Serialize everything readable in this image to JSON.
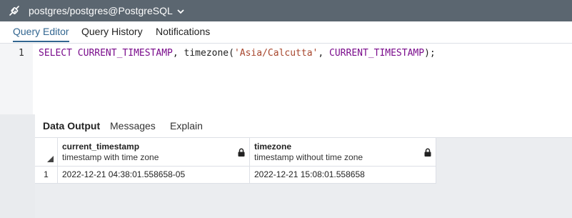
{
  "connection": {
    "title": "postgres/postgres@PostgreSQL",
    "icon": "plug-icon"
  },
  "tabs": [
    {
      "label": "Query Editor",
      "active": true
    },
    {
      "label": "Query History",
      "active": false
    },
    {
      "label": "Notifications",
      "active": false
    }
  ],
  "editor": {
    "line_number": "1",
    "tokens": {
      "kw_select": "SELECT",
      "kw_current_timestamp_1": "CURRENT_TIMESTAMP",
      "txt_comma_1": ", timezone(",
      "str_zone": "'Asia/Calcutta'",
      "txt_comma_2": ", ",
      "kw_current_timestamp_2": "CURRENT_TIMESTAMP",
      "txt_end": ");"
    }
  },
  "results": {
    "tabs": [
      {
        "label": "Data Output",
        "active": true
      },
      {
        "label": "Messages",
        "active": false
      },
      {
        "label": "Explain",
        "active": false
      }
    ],
    "columns": [
      {
        "name": "current_timestamp",
        "type": "timestamp with time zone",
        "locked": true
      },
      {
        "name": "timezone",
        "type": "timestamp without time zone",
        "locked": true
      }
    ],
    "rows": [
      {
        "row_number": "1",
        "values": [
          "2022-12-21 04:38:01.558658-05",
          "2022-12-21 15:08:01.558658"
        ]
      }
    ]
  },
  "colors": {
    "title_bar": "#5b6670",
    "accent": "#326690",
    "keyword": "#7a0c8c",
    "string": "#a7462d"
  }
}
